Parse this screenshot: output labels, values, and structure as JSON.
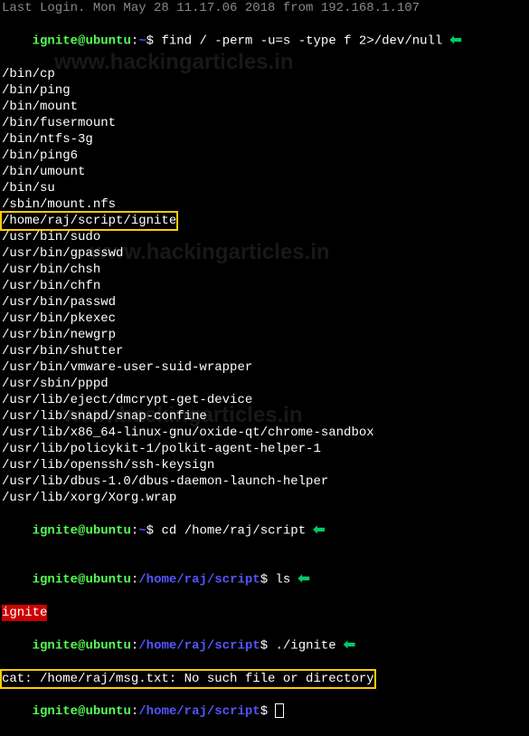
{
  "watermark": "www.hackingarticles.in",
  "top_cut": "Last Login. Mon May 28 11.17.06 2018 from 192.168.1.107",
  "prompt1": {
    "user": "ignite",
    "host": "ubuntu",
    "path": "~",
    "cmd": "find / -perm -u=s -type f 2>/dev/null"
  },
  "find_output": [
    "/bin/cp",
    "/bin/ping",
    "/bin/mount",
    "/bin/fusermount",
    "/bin/ntfs-3g",
    "/bin/ping6",
    "/bin/umount",
    "/bin/su",
    "/sbin/mount.nfs"
  ],
  "highlighted_path": "/home/raj/script/ignite",
  "find_output2": [
    "/usr/bin/sudo",
    "/usr/bin/gpasswd",
    "/usr/bin/chsh",
    "/usr/bin/chfn",
    "/usr/bin/passwd",
    "/usr/bin/pkexec",
    "/usr/bin/newgrp",
    "/usr/bin/shutter",
    "/usr/bin/vmware-user-suid-wrapper",
    "/usr/sbin/pppd",
    "/usr/lib/eject/dmcrypt-get-device",
    "/usr/lib/snapd/snap-confine",
    "/usr/lib/x86_64-linux-gnu/oxide-qt/chrome-sandbox",
    "/usr/lib/policykit-1/polkit-agent-helper-1",
    "/usr/lib/openssh/ssh-keysign",
    "/usr/lib/dbus-1.0/dbus-daemon-launch-helper",
    "/usr/lib/xorg/Xorg.wrap"
  ],
  "prompt2": {
    "user": "ignite",
    "host": "ubuntu",
    "path": "~",
    "cmd": "cd /home/raj/script"
  },
  "prompt3": {
    "user": "ignite",
    "host": "ubuntu",
    "path": "/home/raj/script",
    "cmd": "ls"
  },
  "ls_output": "ignite",
  "prompt4": {
    "user": "ignite",
    "host": "ubuntu",
    "path": "/home/raj/script",
    "cmd": "./ignite"
  },
  "error_output": "cat: /home/raj/msg.txt: No such file or directory",
  "prompt5": {
    "user": "ignite",
    "host": "ubuntu",
    "path": "/home/raj/script",
    "cmd": ""
  },
  "arrow_glyph": "⬅"
}
